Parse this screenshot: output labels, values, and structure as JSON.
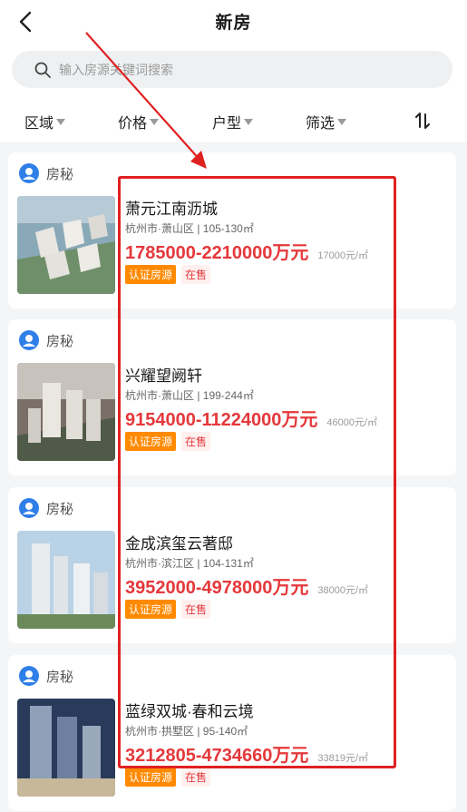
{
  "header": {
    "title": "新房"
  },
  "search": {
    "placeholder": "输入房源关键词搜索"
  },
  "filters": [
    "区域",
    "价格",
    "户型",
    "筛选"
  ],
  "colors": {
    "price": "#e5383b",
    "cert_tag": "#ff8a00",
    "annotation": "#e02020"
  },
  "listings": [
    {
      "source": "房秘",
      "name": "萧元江南沥城",
      "meta": "杭州市·萧山区 | 105-130㎡",
      "price": "1785000-2210000万元",
      "unit_price": "17000元/㎡",
      "tag_cert": "认证房源",
      "tag_status": "在售"
    },
    {
      "source": "房秘",
      "name": "兴耀望阙轩",
      "meta": "杭州市·萧山区 | 199-244㎡",
      "price": "9154000-11224000万元",
      "unit_price": "46000元/㎡",
      "tag_cert": "认证房源",
      "tag_status": "在售"
    },
    {
      "source": "房秘",
      "name": "金成滨玺云著邸",
      "meta": "杭州市·滨江区 | 104-131㎡",
      "price": "3952000-4978000万元",
      "unit_price": "38000元/㎡",
      "tag_cert": "认证房源",
      "tag_status": "在售"
    },
    {
      "source": "房秘",
      "name": "蓝绿双城·春和云境",
      "meta": "杭州市·拱墅区 | 95-140㎡",
      "price": "3212805-4734660万元",
      "unit_price": "33819元/㎡",
      "tag_cert": "认证房源",
      "tag_status": "在售"
    }
  ]
}
